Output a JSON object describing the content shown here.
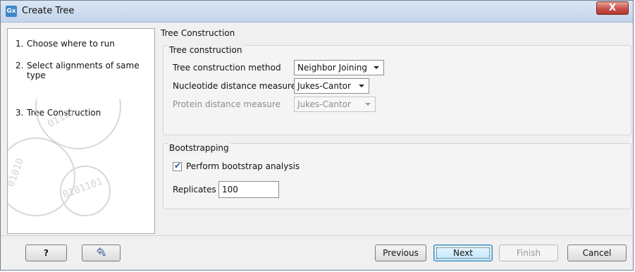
{
  "window": {
    "title": "Create Tree",
    "app_icon_text": "Gx",
    "close_label": "X"
  },
  "steps": [
    {
      "num": "1.",
      "label": "Choose where to run"
    },
    {
      "num": "2.",
      "label": "Select alignments of same type"
    },
    {
      "num": "3.",
      "label": "Tree Construction"
    }
  ],
  "section_title": "Tree Construction",
  "tree_construction": {
    "group_title": "Tree construction",
    "method_label": "Tree construction method",
    "method_value": "Neighbor Joining",
    "nucleotide_label": "Nucleotide distance measure",
    "nucleotide_value": "Jukes-Cantor",
    "protein_label": "Protein distance measure",
    "protein_value": "Jukes-Cantor"
  },
  "bootstrapping": {
    "group_title": "Bootstrapping",
    "perform_label": "Perform bootstrap analysis",
    "perform_checked": true,
    "replicates_label": "Replicates",
    "replicates_value": "100"
  },
  "buttons": {
    "help": "?",
    "previous": "Previous",
    "next": "Next",
    "finish": "Finish",
    "cancel": "Cancel"
  },
  "colors": {
    "accent": "#3c7fb1",
    "close": "#c75050"
  }
}
